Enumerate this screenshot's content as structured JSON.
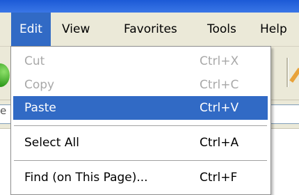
{
  "menubar": {
    "items": [
      {
        "label": "Edit"
      },
      {
        "label": "View"
      },
      {
        "label": "Favorites"
      },
      {
        "label": "Tools"
      },
      {
        "label": "Help"
      }
    ],
    "active_index": 0
  },
  "address": {
    "visible_text": "e"
  },
  "edit_menu": {
    "items": [
      {
        "label": "Cut",
        "shortcut": "Ctrl+X",
        "enabled": false
      },
      {
        "label": "Copy",
        "shortcut": "Ctrl+C",
        "enabled": false
      },
      {
        "label": "Paste",
        "shortcut": "Ctrl+V",
        "enabled": true,
        "highlighted": true
      },
      {
        "label": "Select All",
        "shortcut": "Ctrl+A",
        "enabled": true
      },
      {
        "label": "Find (on This Page)...",
        "shortcut": "Ctrl+F",
        "enabled": true
      }
    ]
  },
  "colors": {
    "highlight": "#316ac5",
    "menubar_bg": "#ebe9d8",
    "title_bar": "#2a63d8",
    "disabled_text": "#a8a8a8"
  },
  "icons": [
    "back-arrow-icon",
    "pencil-edit-icon"
  ]
}
